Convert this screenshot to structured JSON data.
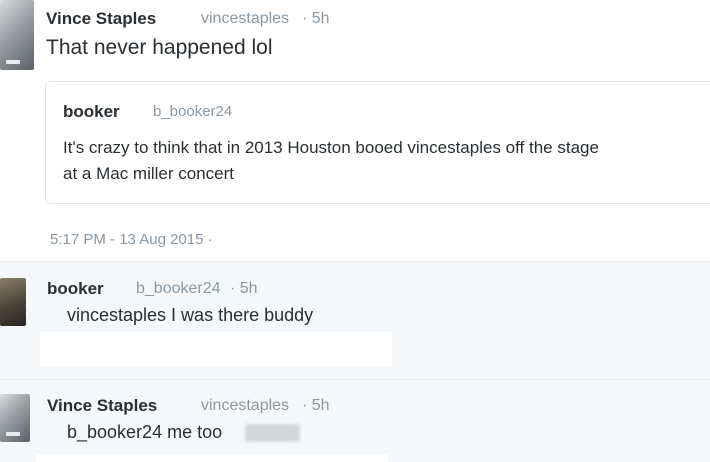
{
  "main_tweet": {
    "name": "Vince Staples",
    "handle": "vincestaples",
    "time": "· 5h",
    "text": "That never happened lol",
    "quote": {
      "name": "booker",
      "handle": "b_booker24",
      "line1": "It's crazy to think that in 2013 Houston booed  vincestaples off the stage",
      "line2": "at a Mac miller concert"
    },
    "timestamp": "5:17 PM - 13 Aug 2015 ·"
  },
  "replies": [
    {
      "name": "booker",
      "handle": "b_booker24",
      "time": "· 5h",
      "text": "vincestaples I was there buddy"
    },
    {
      "name": "Vince Staples",
      "handle": "vincestaples",
      "time": "· 5h",
      "text": "b_booker24 me too"
    }
  ],
  "colors": {
    "primary_text": "#292f33",
    "secondary_text": "#8899a6",
    "reply_background": "#f5f8fa",
    "border": "#e1e8ed"
  }
}
